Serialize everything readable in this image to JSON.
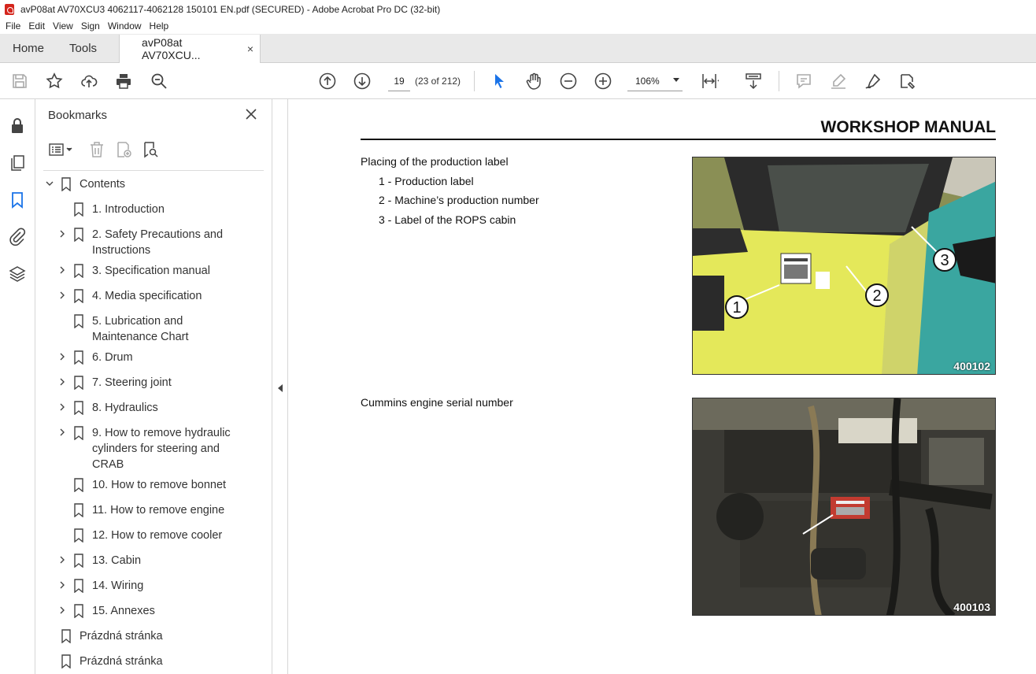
{
  "window": {
    "title": "avP08at AV70XCU3 4062117-4062128 150101 EN.pdf (SECURED) - Adobe Acrobat Pro DC (32-bit)"
  },
  "menu": [
    "File",
    "Edit",
    "View",
    "Sign",
    "Window",
    "Help"
  ],
  "tabs": {
    "home": "Home",
    "tools": "Tools",
    "document": "avP08at AV70XCU...",
    "close": "×"
  },
  "toolbar": {
    "page_number": "19",
    "page_of": "(23 of 212)",
    "zoom": "106%"
  },
  "bookmarks": {
    "title": "Bookmarks",
    "items": [
      {
        "label": "Contents",
        "level": 0,
        "expandable": true,
        "expanded": true
      },
      {
        "label": "1. Introduction",
        "level": 1,
        "expandable": false
      },
      {
        "label": "2. Safety Precautions and Instructions",
        "level": 1,
        "expandable": true
      },
      {
        "label": "3. Specification manual",
        "level": 1,
        "expandable": true
      },
      {
        "label": "4. Media specification",
        "level": 1,
        "expandable": true
      },
      {
        "label": "5. Lubrication and Maintenance Chart",
        "level": 1,
        "expandable": false
      },
      {
        "label": "6. Drum",
        "level": 1,
        "expandable": true
      },
      {
        "label": "7. Steering joint",
        "level": 1,
        "expandable": true
      },
      {
        "label": "8. Hydraulics",
        "level": 1,
        "expandable": true
      },
      {
        "label": "9. How to remove hydraulic cylinders for steering and CRAB",
        "level": 1,
        "expandable": true
      },
      {
        "label": "10. How to remove bonnet",
        "level": 1,
        "expandable": false
      },
      {
        "label": "11. How to remove engine",
        "level": 1,
        "expandable": false
      },
      {
        "label": "12. How to remove cooler",
        "level": 1,
        "expandable": false
      },
      {
        "label": "13. Cabin",
        "level": 1,
        "expandable": true
      },
      {
        "label": "14. Wiring",
        "level": 1,
        "expandable": true
      },
      {
        "label": "15. Annexes",
        "level": 1,
        "expandable": true
      },
      {
        "label": "Prázdná stránka",
        "level": 0,
        "expandable": false
      },
      {
        "label": "Prázdná stránka",
        "level": 0,
        "expandable": false
      }
    ]
  },
  "document": {
    "header": "WORKSHOP MANUAL",
    "section1": {
      "heading": "Placing of the production label",
      "lines": [
        "1 - Production label",
        "2 - Machine’s production number",
        "3 - Label of the ROPS cabin"
      ],
      "photo_number": "400102",
      "callouts": [
        "1",
        "2",
        "3"
      ]
    },
    "section2": {
      "heading": "Cummins engine serial number",
      "photo_number": "400103"
    }
  }
}
